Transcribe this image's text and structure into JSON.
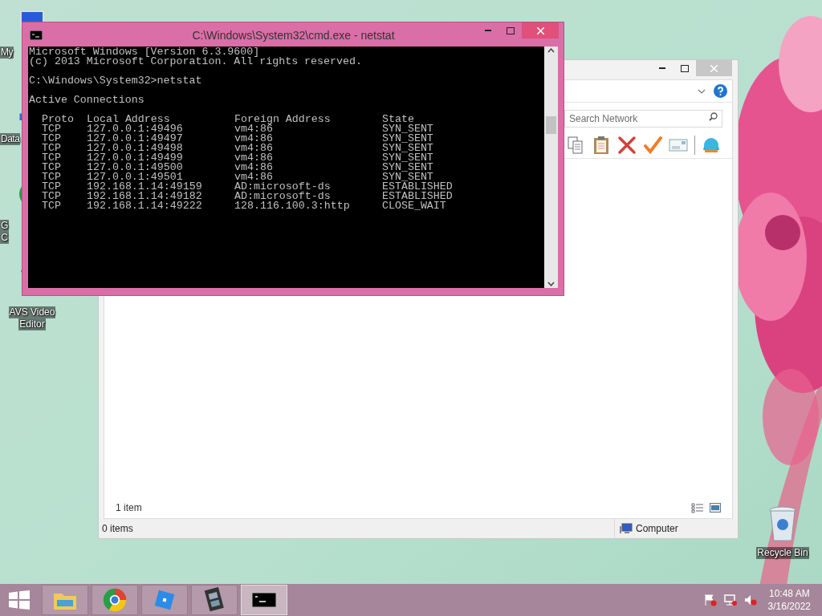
{
  "desktop_icons": [
    {
      "kind": "computer",
      "label": [
        "My"
      ]
    },
    {
      "kind": "shortcut",
      "label": [
        "Data"
      ]
    },
    {
      "kind": "chrome",
      "label": [
        "G",
        "C"
      ]
    },
    {
      "kind": "film",
      "label": [
        "AVS Video",
        "Editor"
      ]
    }
  ],
  "recycle_bin": {
    "label": "Recycle Bin"
  },
  "explorer": {
    "search": {
      "placeholder": "Search Network"
    },
    "toolbar": [
      {
        "kind": "copy"
      },
      {
        "kind": "paste"
      },
      {
        "kind": "delete"
      },
      {
        "kind": "check"
      },
      {
        "kind": "card"
      },
      {
        "kind": "shell"
      }
    ],
    "item_count": "1 item",
    "status_bar": {
      "selection": "0 items",
      "location": "Computer"
    }
  },
  "console_window": {
    "title": "C:\\Windows\\System32\\cmd.exe - netstat",
    "banner": [
      "Microsoft Windows [Version 6.3.9600]",
      "(c) 2013 Microsoft Corporation. All rights reserved."
    ],
    "prompt": "C:\\Windows\\System32>netstat",
    "heading": "Active Connections",
    "table": {
      "columns": [
        "Proto",
        "Local Address",
        "Foreign Address",
        "State"
      ],
      "rows": [
        [
          "TCP",
          "127.0.0.1:49496",
          "vm4:86",
          "SYN_SENT"
        ],
        [
          "TCP",
          "127.0.0.1:49497",
          "vm4:86",
          "SYN_SENT"
        ],
        [
          "TCP",
          "127.0.0.1:49498",
          "vm4:86",
          "SYN_SENT"
        ],
        [
          "TCP",
          "127.0.0.1:49499",
          "vm4:86",
          "SYN_SENT"
        ],
        [
          "TCP",
          "127.0.0.1:49500",
          "vm4:86",
          "SYN_SENT"
        ],
        [
          "TCP",
          "127.0.0.1:49501",
          "vm4:86",
          "SYN_SENT"
        ],
        [
          "TCP",
          "192.168.1.14:49159",
          "AD:microsoft-ds",
          "ESTABLISHED"
        ],
        [
          "TCP",
          "192.168.1.14:49182",
          "AD:microsoft-ds",
          "ESTABLISHED"
        ],
        [
          "TCP",
          "192.168.1.14:49222",
          "128.116.100.3:http",
          "CLOSE_WAIT"
        ]
      ]
    }
  },
  "taskbar": {
    "apps": [
      {
        "kind": "explorer",
        "selected": false
      },
      {
        "kind": "chrome",
        "selected": false
      },
      {
        "kind": "roblox",
        "selected": false
      },
      {
        "kind": "film",
        "selected": false
      },
      {
        "kind": "console",
        "selected": true
      }
    ],
    "clock": {
      "time": "10:48 AM",
      "date": "3/16/2022"
    }
  }
}
